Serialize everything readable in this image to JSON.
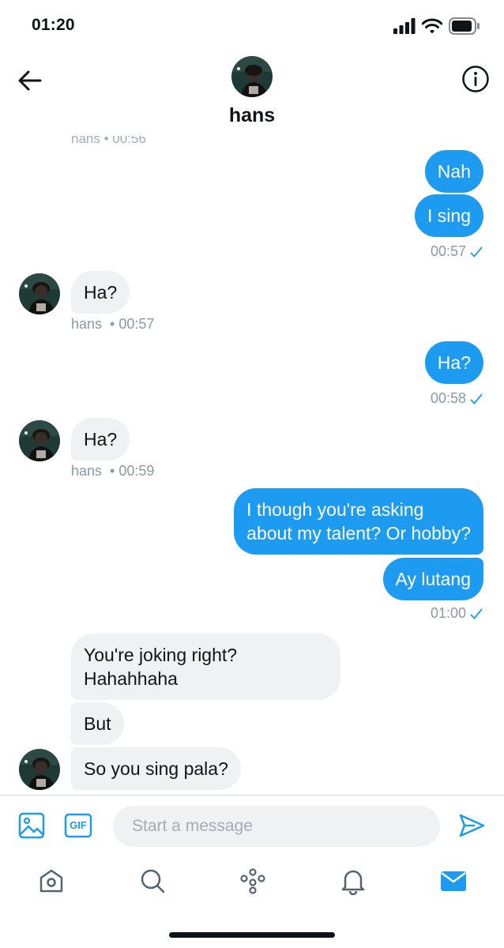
{
  "status": {
    "time": "01:20",
    "icons": [
      "signal-icon",
      "wifi-icon",
      "battery-icon"
    ]
  },
  "header": {
    "name": "hans",
    "back_icon": "back-arrow-icon",
    "info_icon": "info-icon"
  },
  "chat": {
    "cut_off_text": "hans • 00:56",
    "messages": [
      {
        "side": "out",
        "text": "Nah"
      },
      {
        "side": "out",
        "text": "I sing"
      },
      {
        "side": "in",
        "text": "Ha?"
      },
      {
        "side": "out",
        "text": "Ha?"
      },
      {
        "side": "in",
        "text": "Ha?"
      },
      {
        "side": "out",
        "text_line1": "I though you're asking",
        "text_line2": "about my talent? Or hobby?"
      },
      {
        "side": "out",
        "text": "Ay lutang"
      },
      {
        "side": "in",
        "text_line1": "You're joking right?",
        "text_line2": "Hahahhaha"
      },
      {
        "side": "in",
        "text": "But"
      },
      {
        "side": "in",
        "text": "So you sing pala?"
      }
    ],
    "meta": [
      {
        "time": "00:57",
        "read": true
      },
      {
        "sender": "hans",
        "time": "• 00:57"
      },
      {
        "time": "00:58",
        "read": true
      },
      {
        "sender": "hans",
        "time": "• 00:59"
      },
      {
        "time": "01:00",
        "read": true
      }
    ]
  },
  "composer": {
    "placeholder": "Start a message",
    "gif_label": "GIF",
    "media_icon": "image-icon",
    "send_icon": "send-icon"
  },
  "tabs": [
    {
      "name": "home-icon",
      "active": false
    },
    {
      "name": "search-icon",
      "active": false
    },
    {
      "name": "spaces-icon",
      "active": false
    },
    {
      "name": "notifications-icon",
      "active": false
    },
    {
      "name": "messages-icon",
      "active": true
    }
  ],
  "colors": {
    "accent": "#1d9bf0",
    "incoming_bubble": "#eff1f3",
    "meta_text": "#8b98a5"
  }
}
